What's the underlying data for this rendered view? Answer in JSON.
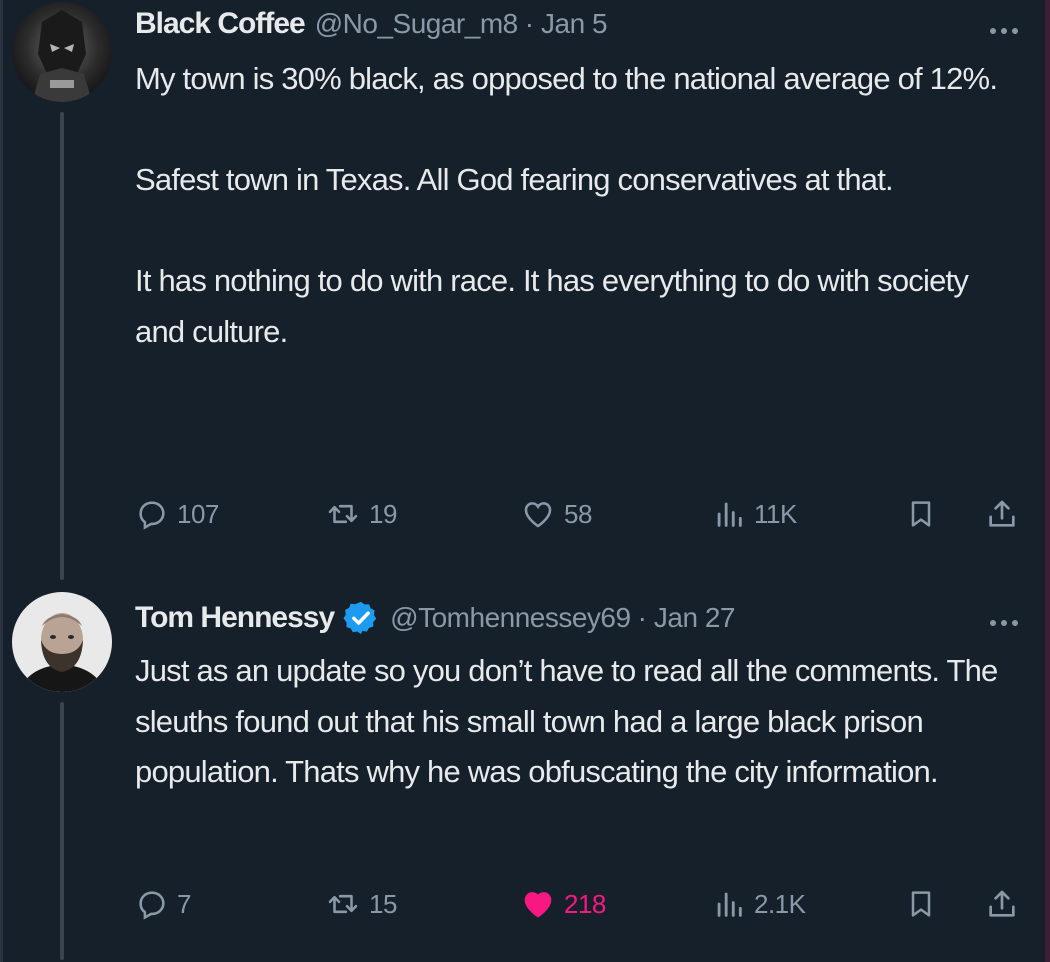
{
  "tweets": [
    {
      "name": "Black Coffee",
      "handle": "@No_Sugar_m8",
      "separator": "·",
      "date": "Jan 5",
      "verified": false,
      "avatar_icon": "dark-mask-avatar",
      "paragraphs": [
        "My town is 30% black, as opposed to the national average of 12%.",
        "Safest town in Texas. All God fearing conservatives at that.",
        "It has nothing to do with race. It has everything to do with society and culture."
      ],
      "actions": {
        "replies": "107",
        "reposts": "19",
        "likes": "58",
        "views": "11K",
        "liked": false
      }
    },
    {
      "name": "Tom Hennessy",
      "handle": "@Tomhennessey69",
      "separator": "·",
      "date": "Jan 27",
      "verified": true,
      "avatar_icon": "bearded-man-avatar",
      "paragraphs": [
        "Just as an update so you don’t have to read all the comments.  The sleuths found out that his small town had a large black prison population. Thats why he was obfuscating the city information."
      ],
      "actions": {
        "replies": "7",
        "reposts": "15",
        "likes": "218",
        "views": "2.1K",
        "liked": true
      }
    }
  ],
  "colors": {
    "background": "#15202b",
    "text": "#e7e9ea",
    "muted": "#8b98a5",
    "like": "#f91880",
    "verified": "#1d9bf0"
  },
  "icons": [
    "reply-icon",
    "repost-icon",
    "like-icon",
    "views-icon",
    "bookmark-icon",
    "share-icon",
    "more-icon",
    "verified-badge-icon"
  ]
}
